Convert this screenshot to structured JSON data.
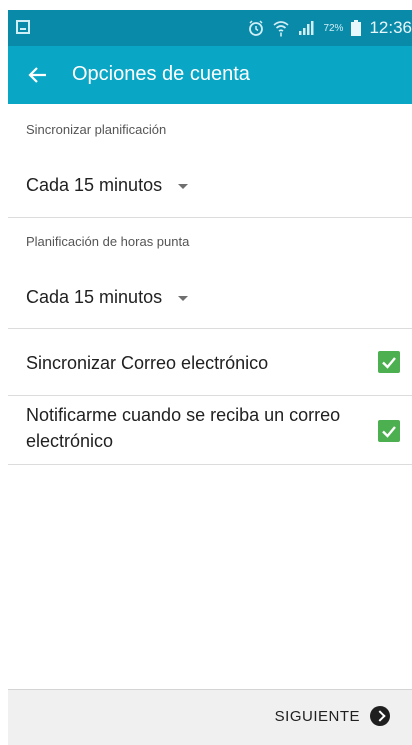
{
  "status_bar": {
    "battery_percent": "72%",
    "time": "12:36",
    "icons": [
      "screenshot-icon",
      "alarm-icon",
      "wifi-icon",
      "signal-icon",
      "battery-icon"
    ]
  },
  "app_bar": {
    "title": "Opciones de cuenta",
    "back_icon": "arrow-back-icon"
  },
  "settings": {
    "sync_schedule": {
      "label": "Sincronizar planificación",
      "value": "Cada 15 minutos"
    },
    "peak_schedule": {
      "label": "Planificación de horas punta",
      "value": "Cada 15 minutos"
    },
    "sync_email": {
      "label": "Sincronizar Correo electrónico",
      "checked": true
    },
    "notify_email": {
      "label": "Notificarme cuando se reciba un correo electrónico",
      "checked": true
    }
  },
  "footer": {
    "next_label": "SIGUIENTE",
    "next_icon": "chevron-right-circle-icon"
  },
  "colors": {
    "status_bar": "#0a8aa9",
    "app_bar": "#0aa6c6",
    "checkbox": "#4caf50"
  }
}
